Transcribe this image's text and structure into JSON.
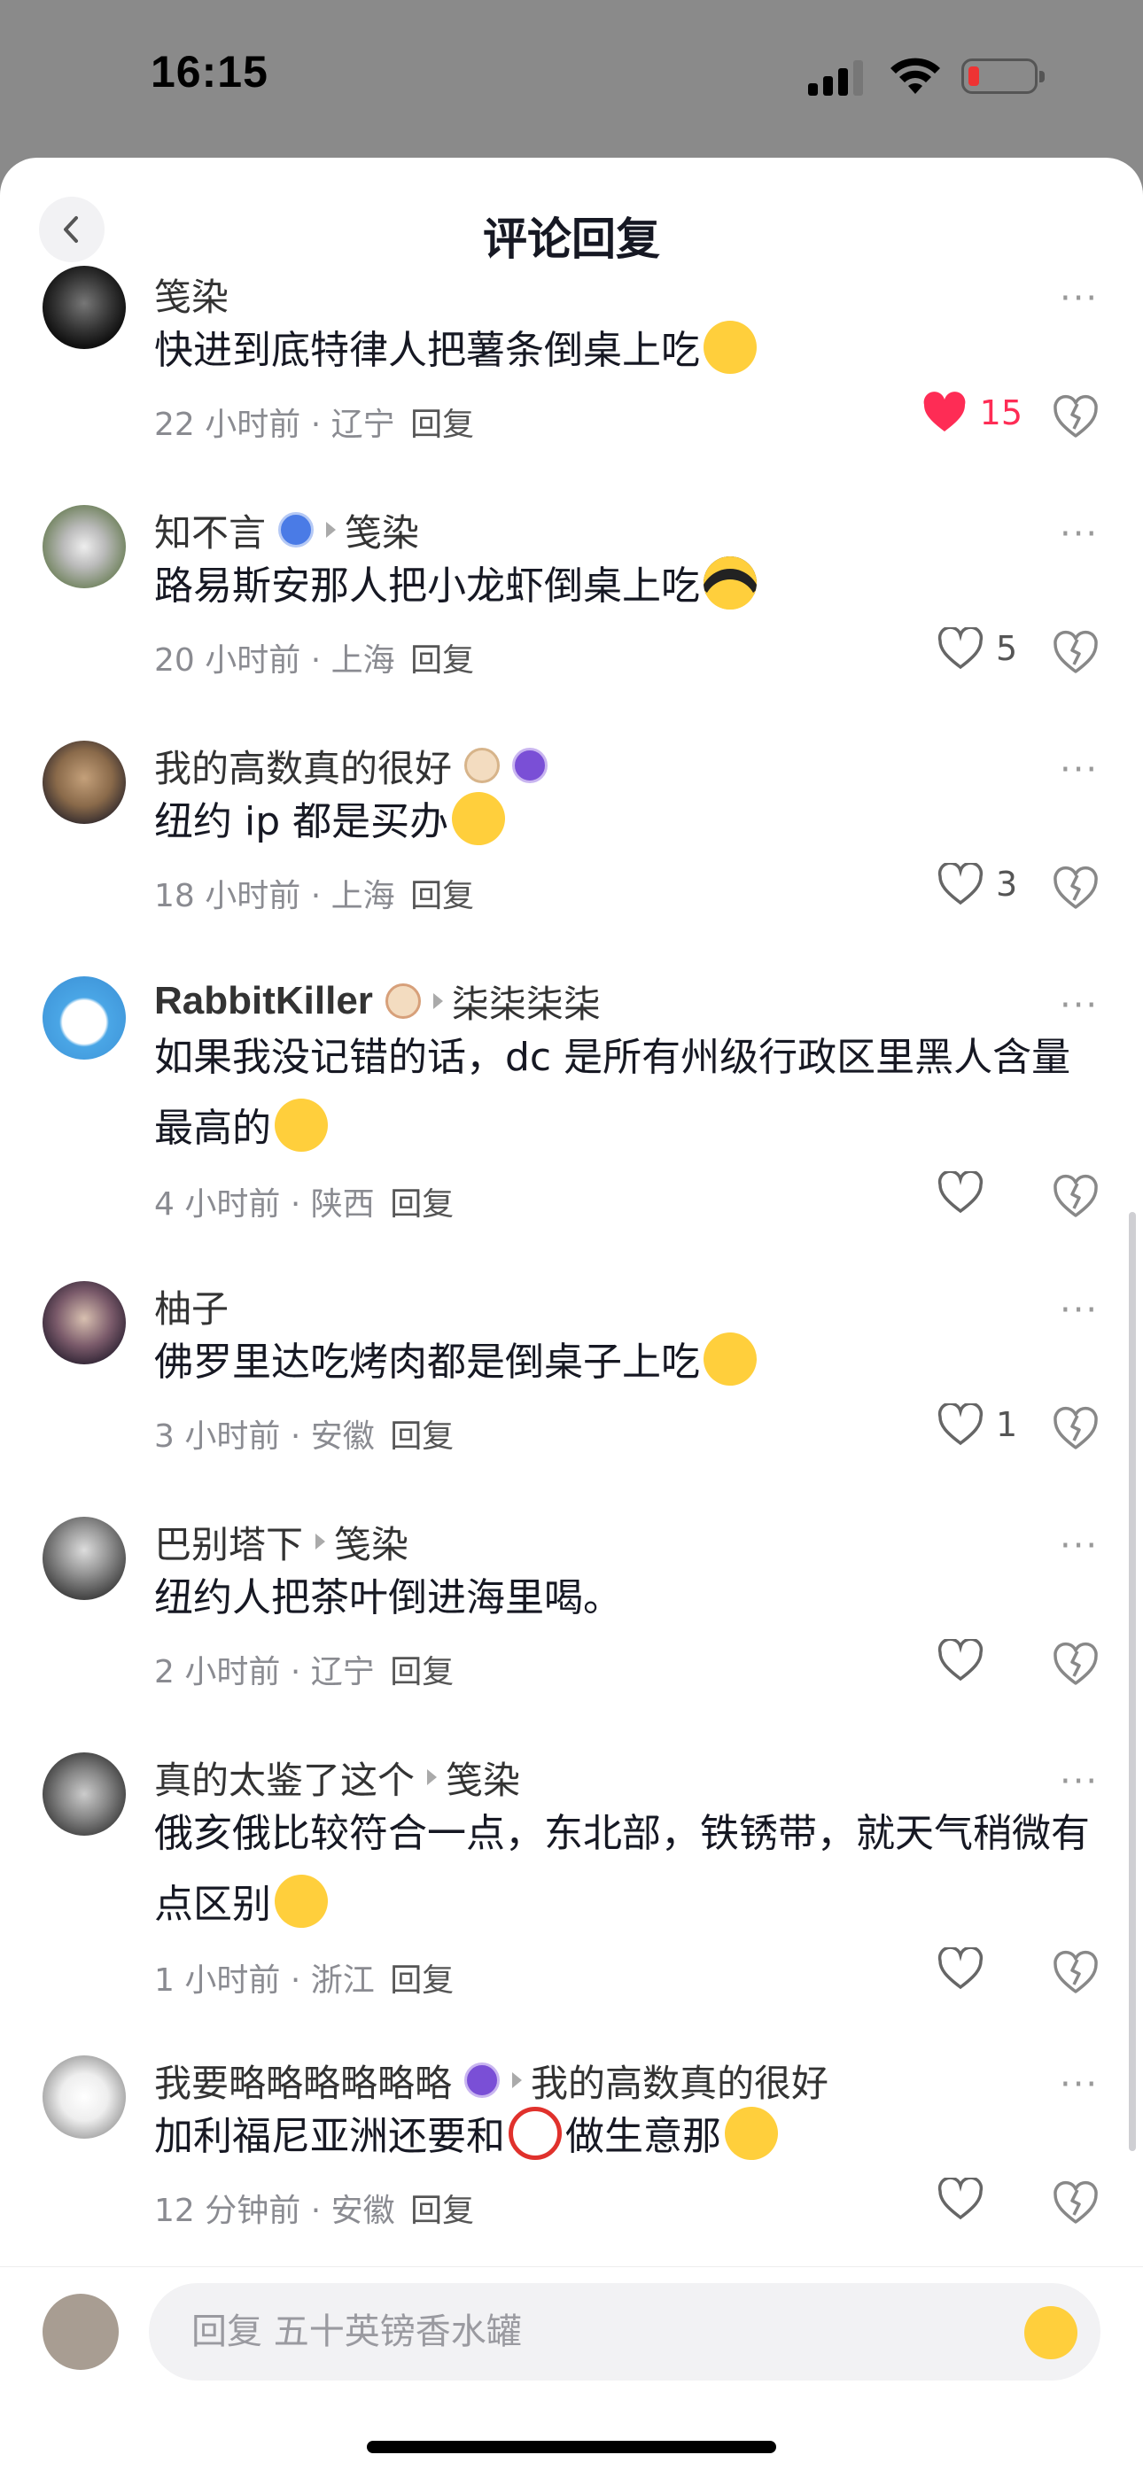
{
  "status_bar": {
    "time": "16:15"
  },
  "header": {
    "title": "评论回复"
  },
  "comments": [
    {
      "name": "笺染",
      "reply_to": "",
      "text": "快进到底特律人把薯条倒桌上吃",
      "time": "22 小时前",
      "location": "辽宁",
      "likes": "15",
      "liked": true
    },
    {
      "name": "知不言",
      "reply_to": "笺染",
      "text": "路易斯安那人把小龙虾倒桌上吃",
      "time": "20 小时前",
      "location": "上海",
      "likes": "5",
      "liked": false
    },
    {
      "name": "我的高数真的很好",
      "reply_to": "",
      "text": "纽约 ip 都是买办",
      "time": "18 小时前",
      "location": "上海",
      "likes": "3",
      "liked": false
    },
    {
      "name": "RabbitKiller",
      "reply_to": "柒柒柒柒",
      "text": "如果我没记错的话，dc 是所有州级行政区里黑人含量最高的",
      "time": "4 小时前",
      "location": "陕西",
      "likes": "",
      "liked": false
    },
    {
      "name": "柚子",
      "reply_to": "",
      "text": "佛罗里达吃烤肉都是倒桌子上吃",
      "time": "3 小时前",
      "location": "安徽",
      "likes": "1",
      "liked": false
    },
    {
      "name": "巴别塔下",
      "reply_to": "笺染",
      "text": "纽约人把茶叶倒进海里喝。",
      "time": "2 小时前",
      "location": "辽宁",
      "likes": "",
      "liked": false
    },
    {
      "name": "真的太鉴了这个",
      "reply_to": "笺染",
      "text": "俄亥俄比较符合一点，东北部，铁锈带，就天气稍微有点区别",
      "time": "1 小时前",
      "location": "浙江",
      "likes": "",
      "liked": false
    },
    {
      "name": "我要略略略略略略",
      "reply_to": "我的高数真的很好",
      "text": "加利福尼亚洲还要和",
      "text_after": "做生意那",
      "time": "12 分钟前",
      "location": "安徽",
      "likes": "",
      "liked": false
    }
  ],
  "ui": {
    "reply_label": "回复",
    "separator": "·",
    "more": "···"
  },
  "input": {
    "placeholder": "回复 五十英镑香水罐"
  },
  "colors": {
    "like_red": "#fe2c55",
    "text": "#161823",
    "meta": "#8a8b91"
  }
}
